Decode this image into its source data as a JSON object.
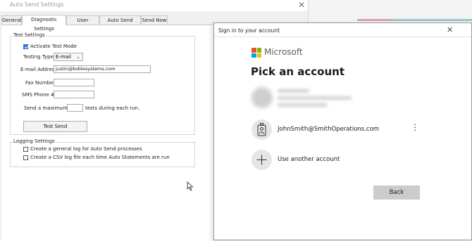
{
  "app": {
    "title": "Auto Send Settings",
    "tabs": [
      "General",
      "Diagnostic Settings",
      "User Settings",
      "Auto Send Modes",
      "Send Now"
    ],
    "active_tab": "Diagnostic Settings"
  },
  "test_settings": {
    "group_title": "Test Settings",
    "activate_test_mode_label": "Activate Test Mode",
    "activate_test_mode_checked": true,
    "testing_type_label": "Testing Type:",
    "testing_type_value": "E-mail",
    "email_label": "E-mail Address:",
    "email_value": "justin@koblesystems.com",
    "fax_label": "Fax Number:",
    "fax_value": "",
    "sms_label": "SMS Phone #:",
    "sms_value": "",
    "max_prefix": "Send a maximum of",
    "max_value": "",
    "max_suffix": "tests during each run.",
    "test_send_label": "Test Send"
  },
  "logging_settings": {
    "group_title": "Logging Settings",
    "general_log_label": "Create a general log for Auto Send processes",
    "general_log_checked": false,
    "csv_log_label": "Create a CSV log file each time Auto Statements are run",
    "csv_log_checked": false
  },
  "dialog": {
    "title": "Sign in to your account",
    "brand": "Microsoft",
    "heading": "Pick an account",
    "account_email": "JohnSmith@SmithOperations.com",
    "add_account_label": "Use another account",
    "back_label": "Back",
    "logo_colors": [
      "#f25022",
      "#7fba00",
      "#00a4ef",
      "#ffb900"
    ]
  },
  "icons": {
    "close": "close-icon",
    "more": "more-options-icon",
    "badge": "badge-person-icon",
    "plus": "plus-icon",
    "cursor": "mouse-pointer-icon"
  }
}
